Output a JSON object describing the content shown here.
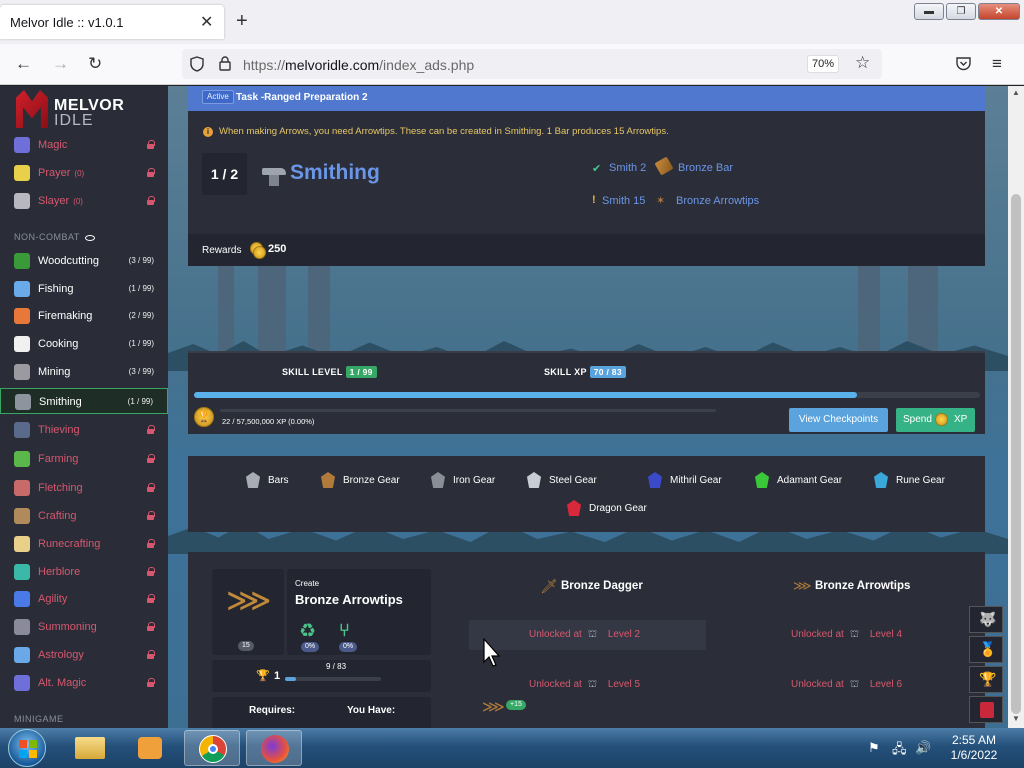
{
  "browser": {
    "tab_title": "Melvor Idle :: v1.0.1",
    "tab_close": "✕",
    "new_tab": "+",
    "url_prefix": "https://",
    "url_domain": "melvoridle.com",
    "url_path": "/index_ads.php",
    "zoom": "70%",
    "window_buttons": {
      "minimize": "▬",
      "restore": "❐",
      "close": "✕"
    }
  },
  "sidebar": {
    "logo_line1": "MELVOR",
    "logo_line2": "IDLE",
    "combat_items": [
      {
        "label": "Magic",
        "count": "",
        "locked": true,
        "color": "#6e6fd8"
      },
      {
        "label": "Prayer",
        "count": "(0)",
        "locked": true,
        "color": "#e8d04a"
      },
      {
        "label": "Slayer",
        "count": "(0)",
        "locked": true,
        "color": "#b8b8c0"
      }
    ],
    "noncombat_header": "NON-COMBAT",
    "noncombat_items": [
      {
        "label": "Woodcutting",
        "count": "(3 / 99)",
        "locked": false,
        "color": "#3a9a3a"
      },
      {
        "label": "Fishing",
        "count": "(1 / 99)",
        "locked": false,
        "color": "#6aaae8"
      },
      {
        "label": "Firemaking",
        "count": "(2 / 99)",
        "locked": false,
        "color": "#e8783a"
      },
      {
        "label": "Cooking",
        "count": "(1 / 99)",
        "locked": false,
        "color": "#f0f0f0"
      },
      {
        "label": "Mining",
        "count": "(3 / 99)",
        "locked": false,
        "color": "#9a9aa0"
      },
      {
        "label": "Smithing",
        "count": "(1 / 99)",
        "locked": false,
        "selected": true,
        "color": "#8e949e"
      },
      {
        "label": "Thieving",
        "count": "",
        "locked": true,
        "color": "#5a6a8a"
      },
      {
        "label": "Farming",
        "count": "",
        "locked": true,
        "color": "#5ab84a"
      },
      {
        "label": "Fletching",
        "count": "",
        "locked": true,
        "color": "#c86a6a"
      },
      {
        "label": "Crafting",
        "count": "",
        "locked": true,
        "color": "#b08a5a"
      },
      {
        "label": "Runecrafting",
        "count": "",
        "locked": true,
        "color": "#e8d08a"
      },
      {
        "label": "Herblore",
        "count": "",
        "locked": true,
        "color": "#3ab8a8"
      },
      {
        "label": "Agility",
        "count": "",
        "locked": true,
        "color": "#4a7ae8"
      },
      {
        "label": "Summoning",
        "count": "",
        "locked": true,
        "color": "#8a8a9a"
      },
      {
        "label": "Astrology",
        "count": "",
        "locked": true,
        "color": "#6aa8e8"
      },
      {
        "label": "Alt. Magic",
        "count": "",
        "locked": true,
        "color": "#6e6fd8"
      }
    ],
    "minigame_header": "MINIGAME"
  },
  "task": {
    "badge": "Active",
    "name": "Task -Ranged Preparation 2",
    "tip": "When making Arrows, you need Arrowtips. These can be created in Smithing. 1 Bar produces 15 Arrowtips.",
    "progress": "1 / 2",
    "skill": "Smithing",
    "requirements": [
      {
        "status": "done",
        "text": "Smith 2",
        "item": "Bronze Bar"
      },
      {
        "status": "pending",
        "text": "Smith 15",
        "item": "Bronze Arrowtips"
      }
    ],
    "rewards_label": "Rewards",
    "rewards_gp": "250"
  },
  "skill": {
    "level_label": "SKILL LEVEL",
    "level_value": "1 / 99",
    "xp_label": "SKILL XP",
    "xp_value": "70 / 83",
    "xp_progress": 0.843,
    "mastery_text": "22 / 57,500,000 XP (0.00%)",
    "view_checkpoints": "View Checkpoints",
    "spend_label": "Spend",
    "spend_xp": "XP"
  },
  "categories": [
    {
      "label": "Bars",
      "color": "#a8acb4"
    },
    {
      "label": "Bronze Gear",
      "color": "#b07a3a"
    },
    {
      "label": "Iron Gear",
      "color": "#8a8e96"
    },
    {
      "label": "Steel Gear",
      "color": "#c8ccd4"
    },
    {
      "label": "Mithril Gear",
      "color": "#3a4ac8"
    },
    {
      "label": "Adamant Gear",
      "color": "#3ac83a"
    },
    {
      "label": "Rune Gear",
      "color": "#3aa8d8"
    },
    {
      "label": "Dragon Gear",
      "color": "#d8283a"
    }
  ],
  "recipe": {
    "create_label": "Create",
    "item_name": "Bronze Arrowtips",
    "quantity": "15",
    "preserve_pct": "0%",
    "double_pct": "0%",
    "mastery_level": "1",
    "mastery_xp": "9 / 83",
    "requires_label": "Requires:",
    "you_have_label": "You Have:"
  },
  "unlocks": {
    "col1_title": "Bronze Dagger",
    "col2_title": "Bronze Arrowtips",
    "unlocked_at": "Unlocked at",
    "levels": [
      "Level 2",
      "Level 4",
      "Level 5",
      "Level 6"
    ],
    "plus_badge": "+15"
  },
  "taskbar": {
    "time": "2:55 AM",
    "date": "1/6/2022"
  }
}
